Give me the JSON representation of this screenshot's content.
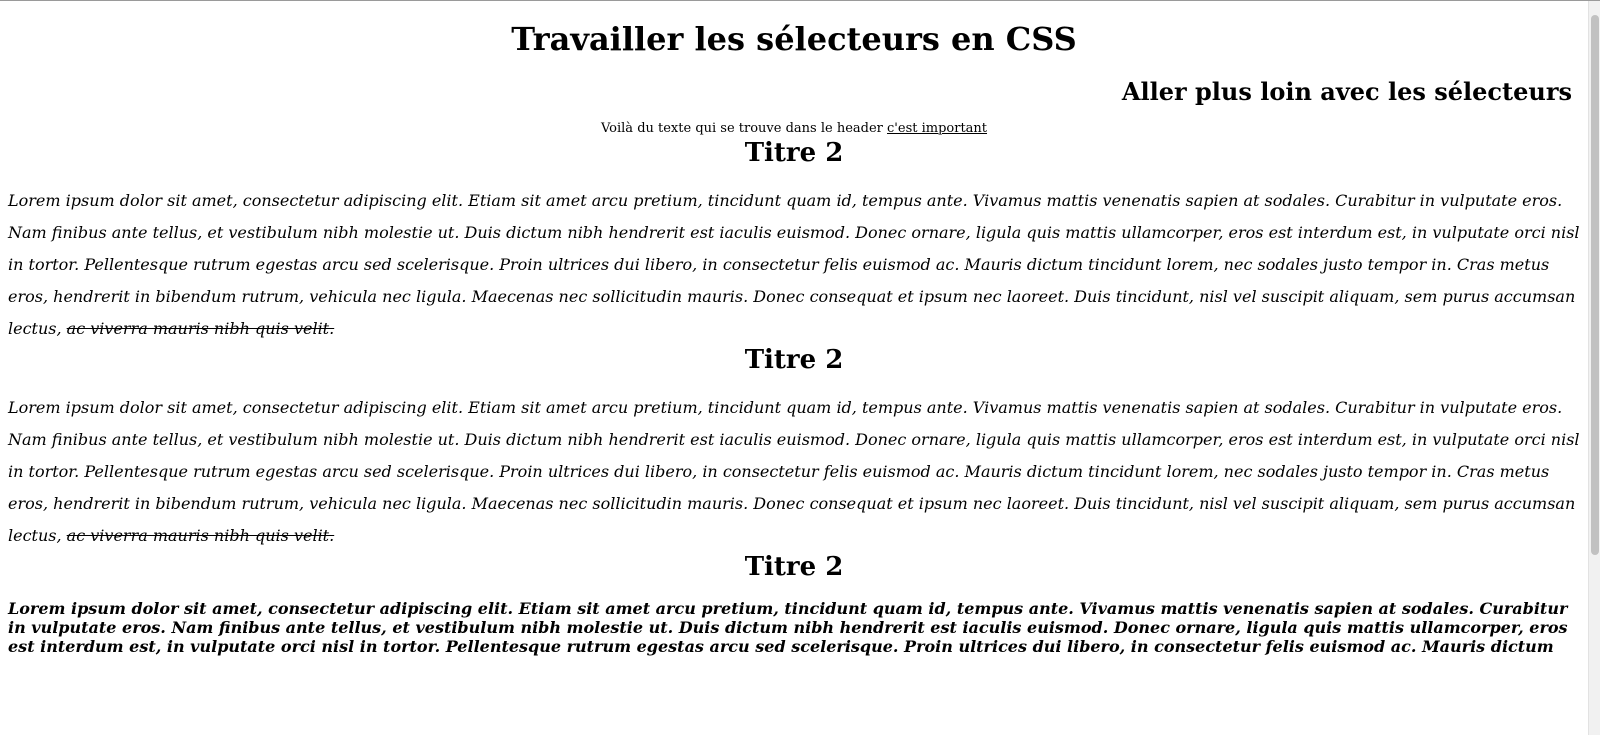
{
  "page": {
    "title": "Travailler les sélecteurs en CSS",
    "subtitle": "Aller plus loin avec les sélecteurs",
    "header_text": "Voilà du texte qui se trouve dans le header ",
    "header_important": "c'est important"
  },
  "sections": [
    {
      "title": "Titre 2",
      "text": "Lorem ipsum dolor sit amet, consectetur adipiscing elit. Etiam sit amet arcu pretium, tincidunt quam id, tempus ante. Vivamus mattis venenatis sapien at sodales. Curabitur in vulputate eros. Nam finibus ante tellus, et vestibulum nibh molestie ut. Duis dictum nibh hendrerit est iaculis euismod. Donec ornare, ligula quis mattis ullamcorper, eros est interdum est, in vulputate orci nisl in tortor. Pellentesque rutrum egestas arcu sed scelerisque. Proin ultrices dui libero, in consectetur felis euismod ac. Mauris dictum tincidunt lorem, nec sodales justo tempor in. Cras metus eros, hendrerit in bibendum rutrum, vehicula nec ligula. Maecenas nec sollicitudin mauris. Donec consequat et ipsum nec laoreet. Duis tincidunt, nisl vel suscipit aliquam, sem purus accumsan lectus, ",
      "struck": "ac viverra mauris nibh quis velit."
    },
    {
      "title": "Titre 2",
      "text": "Lorem ipsum dolor sit amet, consectetur adipiscing elit. Etiam sit amet arcu pretium, tincidunt quam id, tempus ante. Vivamus mattis venenatis sapien at sodales. Curabitur in vulputate eros. Nam finibus ante tellus, et vestibulum nibh molestie ut. Duis dictum nibh hendrerit est iaculis euismod. Donec ornare, ligula quis mattis ullamcorper, eros est interdum est, in vulputate orci nisl in tortor. Pellentesque rutrum egestas arcu sed scelerisque. Proin ultrices dui libero, in consectetur felis euismod ac. Mauris dictum tincidunt lorem, nec sodales justo tempor in. Cras metus eros, hendrerit in bibendum rutrum, vehicula nec ligula. Maecenas nec sollicitudin mauris. Donec consequat et ipsum nec laoreet. Duis tincidunt, nisl vel suscipit aliquam, sem purus accumsan lectus, ",
      "struck": "ac viverra mauris nibh quis velit."
    },
    {
      "title": "Titre 2",
      "text": "Lorem ipsum dolor sit amet, consectetur adipiscing elit. Etiam sit amet arcu pretium, tincidunt quam id, tempus ante. Vivamus mattis venenatis sapien at sodales. Curabitur in vulputate eros. Nam finibus ante tellus, et vestibulum nibh molestie ut. Duis dictum nibh hendrerit est iaculis euismod. Donec ornare, ligula quis mattis ullamcorper, eros est interdum est, in vulputate orci nisl in tortor. Pellentesque rutrum egestas arcu sed scelerisque. Proin ultrices dui libero, in consectetur felis euismod ac. Mauris dictum"
    }
  ]
}
